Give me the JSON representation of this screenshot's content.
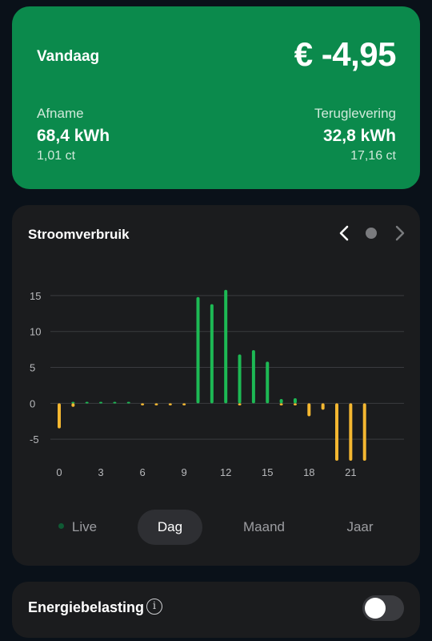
{
  "summary": {
    "title": "Vandaag",
    "amount": "€ -4,95",
    "afname": {
      "label": "Afname",
      "value": "68,4 kWh",
      "price": "1,01 ct"
    },
    "teruglevering": {
      "label": "Teruglevering",
      "value": "32,8 kWh",
      "price": "17,16 ct"
    },
    "color": "#0b8a4c"
  },
  "chart": {
    "title": "Stroomverbruik",
    "nav": {
      "prev_icon": "chevron-left-icon",
      "indicator_icon": "dot-icon",
      "next_icon": "chevron-right-icon"
    }
  },
  "chart_data": {
    "type": "bar",
    "ylim": [
      -8,
      17
    ],
    "yticks": [
      15,
      10,
      5,
      0,
      -5
    ],
    "xtick_labels": [
      "0",
      "3",
      "6",
      "9",
      "12",
      "15",
      "18",
      "21"
    ],
    "xticks": [
      0,
      3,
      6,
      9,
      12,
      15,
      18,
      21
    ],
    "x": [
      0,
      1,
      2,
      3,
      4,
      5,
      6,
      7,
      8,
      9,
      10,
      11,
      12,
      13,
      14,
      15,
      16,
      17,
      18,
      19,
      20,
      21,
      22
    ],
    "series": [
      {
        "color": "#1db954",
        "values": [
          0,
          0.2,
          0.2,
          0.2,
          0.2,
          0.2,
          0,
          0,
          0,
          0,
          14.8,
          13.8,
          15.8,
          6.8,
          7.4,
          5.8,
          0.6,
          0.7,
          0,
          0,
          0,
          0,
          0
        ]
      },
      {
        "color": "#f4b731",
        "values": [
          -3.5,
          -0.5,
          0,
          0,
          0,
          0,
          -0.3,
          -0.3,
          -0.3,
          -0.3,
          0,
          0,
          0,
          -0.3,
          0,
          0,
          -0.3,
          -0.3,
          -1.8,
          -0.9,
          -8,
          -8,
          -8
        ]
      }
    ],
    "grid": true
  },
  "periods": [
    {
      "label": "Live",
      "active": false
    },
    {
      "label": "Dag",
      "active": true
    },
    {
      "label": "Maand",
      "active": false
    },
    {
      "label": "Jaar",
      "active": false
    }
  ],
  "tax": {
    "label": "Energiebelasting",
    "info_icon": "info-icon",
    "enabled": false
  }
}
